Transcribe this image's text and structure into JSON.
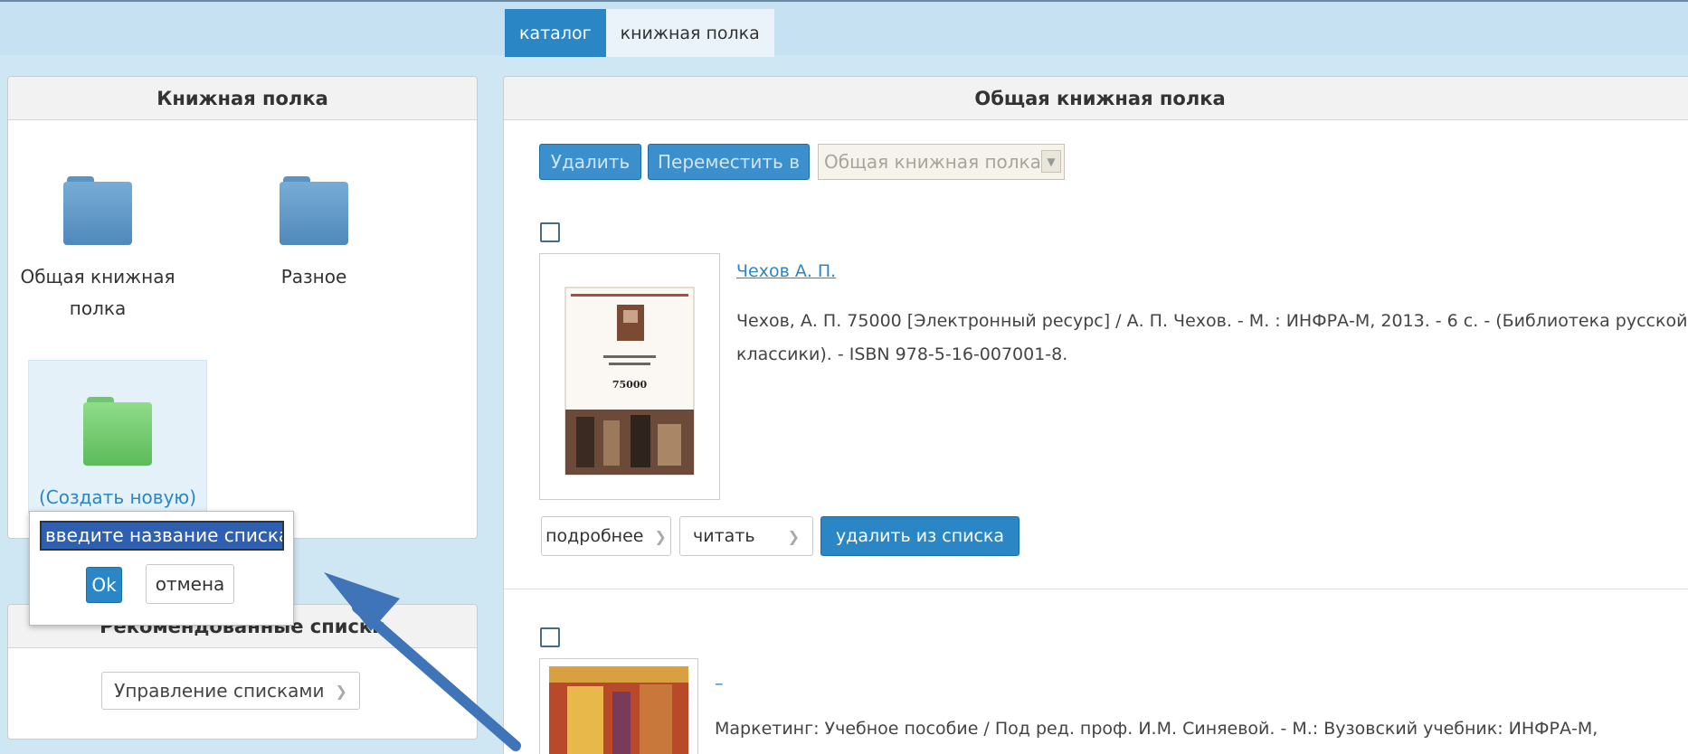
{
  "tabs": [
    {
      "label": "каталог",
      "active": true
    },
    {
      "label": "книжная полка",
      "active": false
    }
  ],
  "left_panel": {
    "title": "Книжная полка",
    "folders": [
      {
        "label": "Общая книжная полка",
        "icon": "folder-icon",
        "color": "#5a94c4"
      },
      {
        "label": "Разное",
        "icon": "folder-icon",
        "color": "#5a94c4"
      },
      {
        "label": "(Создать новую)",
        "icon": "folder-plus-icon",
        "color": "#6fc66f"
      }
    ]
  },
  "popup": {
    "input_value": "введите название списка",
    "ok_label": "Ok",
    "cancel_label": "отмена"
  },
  "rec_panel": {
    "title": "Рекомендованные списки",
    "manage_label": "Управление списками"
  },
  "main": {
    "title": "Общая книжная полка",
    "delete_label": "Удалить",
    "move_label": "Переместить в",
    "move_select_value": "Общая книжная полка",
    "books": [
      {
        "author_link": "Чехов А. П.",
        "description": "Чехов, А. П. 75000 [Электронный ресурс] / А. П. Чехов. - М. : ИНФРА-М, 2013. - 6 с. - (Библиотека русской классики). - ISBN 978-5-16-007001-8.",
        "cover_number": "75000",
        "details_label": "подробнее",
        "read_label": "читать",
        "remove_label": "удалить из списка"
      },
      {
        "author_link": "–",
        "description": "Маркетинг: Учебное пособие / Под ред. проф. И.М. Синяевой. - М.: Вузовский учебник: ИНФРА-М,"
      }
    ]
  },
  "colors": {
    "accent": "#2a86c5",
    "annotation_arrow": "#3f74b8"
  }
}
